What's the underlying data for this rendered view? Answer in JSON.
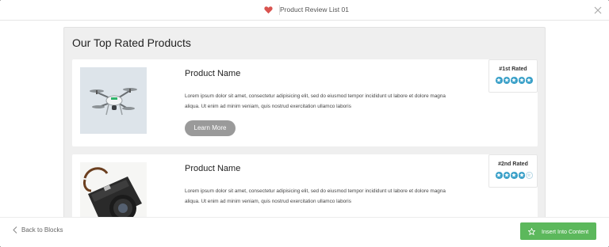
{
  "header": {
    "title": "Product Review List 01"
  },
  "preview": {
    "section_title": "Our Top Rated Products",
    "products": [
      {
        "name": "Product Name",
        "description": "Lorem ipsum dolor sit amet, consectetur adipisicing elit, sed do eiusmod tempor incididunt ut labore et dolore magna aliqua. Ut enim ad minim veniam, quis nostrud exercitation ullamco laboris",
        "button_label": "Learn More",
        "rank_label": "#1st Rated",
        "rating": 5,
        "rating_max": 5,
        "image": "drone-photo"
      },
      {
        "name": "Product Name",
        "description": "Lorem ipsum dolor sit amet, consectetur adipisicing elit, sed do eiusmod tempor incididunt ut labore et dolore magna aliqua. Ut enim ad minim veniam, quis nostrud exercitation ullamco laboris",
        "rank_label": "#2nd Rated",
        "rating": 4,
        "rating_max": 5,
        "image": "camera-photo"
      }
    ]
  },
  "footer": {
    "back_label": "Back to Blocks",
    "insert_label": "Insert Into Content"
  },
  "colors": {
    "accent_green": "#5cb85c",
    "star_blue": "#3aa0c8",
    "heart_red": "#d9534f",
    "button_gray": "#9a9a9a"
  },
  "icons": [
    "heart-icon",
    "close-icon",
    "star-icon",
    "back-chevron-icon",
    "star-outline-icon"
  ]
}
